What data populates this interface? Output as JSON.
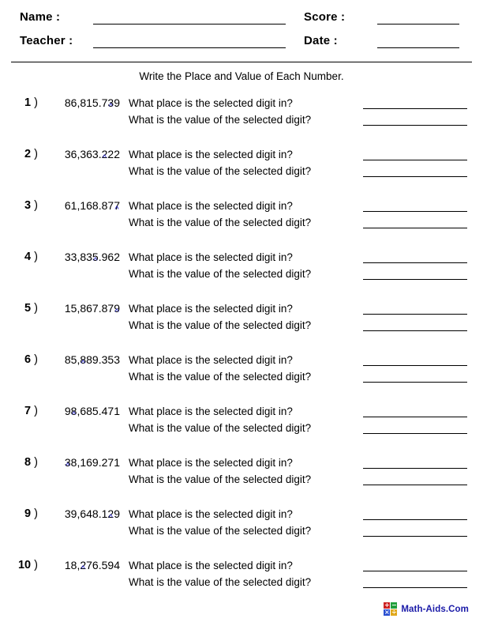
{
  "header": {
    "name_label": "Name :",
    "teacher_label": "Teacher :",
    "score_label": "Score :",
    "date_label": "Date :",
    "name_value": "",
    "teacher_value": "",
    "score_value": "",
    "date_value": ""
  },
  "instructions": "Write the Place and Value of Each Number.",
  "questions": {
    "place": "What place is the selected digit in?",
    "value": "What is the value of the selected digit?"
  },
  "problems": [
    {
      "index": "1",
      "paren": ")",
      "number": "86,815.739",
      "marked_char_index": 8,
      "marked_digit": "3",
      "answer_place": "",
      "answer_value": ""
    },
    {
      "index": "2",
      "paren": ")",
      "number": "36,363.222",
      "marked_char_index": 7,
      "marked_digit": "2",
      "answer_place": "",
      "answer_value": ""
    },
    {
      "index": "3",
      "paren": ")",
      "number": "61,168.877",
      "marked_char_index": 9,
      "marked_digit": "7",
      "answer_place": "",
      "answer_value": ""
    },
    {
      "index": "4",
      "paren": ")",
      "number": "33,835.962",
      "marked_char_index": 5,
      "marked_digit": "5",
      "answer_place": "",
      "answer_value": ""
    },
    {
      "index": "5",
      "paren": ")",
      "number": "15,867.879",
      "marked_char_index": 9,
      "marked_digit": "9",
      "answer_place": "",
      "answer_value": ""
    },
    {
      "index": "6",
      "paren": ")",
      "number": "85,889.353",
      "marked_char_index": 3,
      "marked_digit": "8",
      "answer_place": "",
      "answer_value": ""
    },
    {
      "index": "7",
      "paren": ")",
      "number": "98,685.471",
      "marked_char_index": 1,
      "marked_digit": "8",
      "answer_place": "",
      "answer_value": ""
    },
    {
      "index": "8",
      "paren": ")",
      "number": "38,169.271",
      "marked_char_index": 0,
      "marked_digit": "3",
      "answer_place": "",
      "answer_value": ""
    },
    {
      "index": "9",
      "paren": ")",
      "number": "39,648.129",
      "marked_char_index": 8,
      "marked_digit": "2",
      "answer_place": "",
      "answer_value": ""
    },
    {
      "index": "10",
      "paren": ")",
      "number": "18,276.594",
      "marked_char_index": 3,
      "marked_digit": "2",
      "answer_place": "",
      "answer_value": ""
    }
  ],
  "footer": {
    "brand": "Math-Aids.Com",
    "logo_cells": [
      {
        "symbol": "+",
        "color": "#cc2222"
      },
      {
        "symbol": "−",
        "color": "#22a03c"
      },
      {
        "symbol": "×",
        "color": "#2a4fd0"
      },
      {
        "symbol": "÷",
        "color": "#e0a81c"
      }
    ]
  },
  "colors": {
    "caret": "#2222cc",
    "brand_text": "#1a1aa8",
    "rule": "#000000"
  }
}
